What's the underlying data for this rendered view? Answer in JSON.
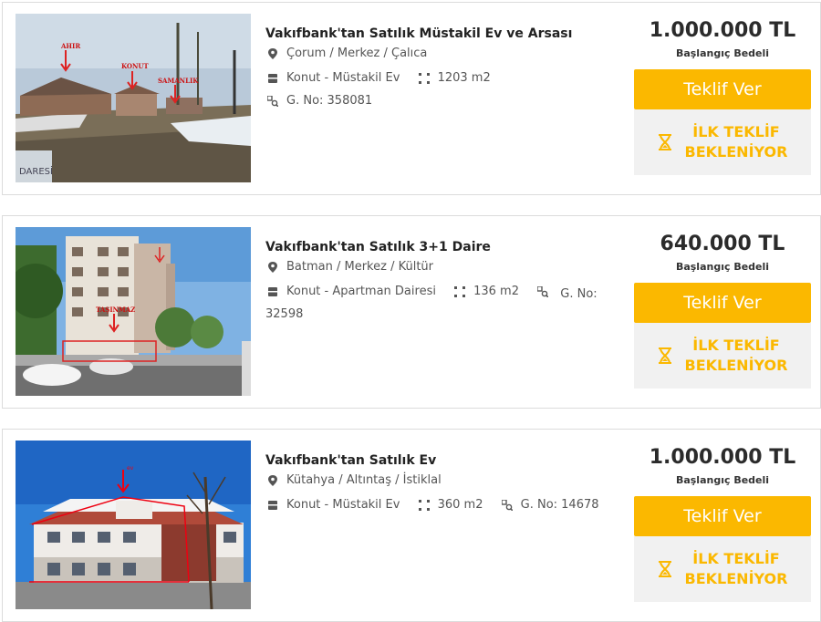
{
  "listings": [
    {
      "title": "Vakıfbank'tan Satılık Müstakil Ev ve Arsası",
      "location": "Çorum / Merkez / Çalıca",
      "type": "Konut - Müstakil Ev",
      "area": "1203 m2",
      "gno": "G. No: 358081",
      "price": "1.000.000 TL",
      "price_label": "Başlangıç Bedeli",
      "bid_button": "Teklif Ver",
      "status_line1": "İLK TEKLİF",
      "status_line2": "BEKLENİYOR",
      "photo_labels": [
        "AHIR",
        "KONUT",
        "SAMANLIK",
        "DARESİ"
      ]
    },
    {
      "title": "Vakıfbank'tan Satılık 3+1 Daire",
      "location": "Batman / Merkez / Kültür",
      "type": "Konut - Apartman Dairesi",
      "area": "136 m2",
      "gno": "G. No: 32598",
      "price": "640.000 TL",
      "price_label": "Başlangıç Bedeli",
      "bid_button": "Teklif Ver",
      "status_line1": "İLK TEKLİF",
      "status_line2": "BEKLENİYOR",
      "photo_labels": [
        "TAŞINMAZ"
      ]
    },
    {
      "title": "Vakıfbank'tan Satılık Ev",
      "location": "Kütahya / Altıntaş / İstiklal",
      "type": "Konut - Müstakil Ev",
      "area": "360 m2",
      "gno": "G. No: 14678",
      "price": "1.000.000 TL",
      "price_label": "Başlangıç Bedeli",
      "bid_button": "Teklif Ver",
      "status_line1": "İLK TEKLİF",
      "status_line2": "BEKLENİYOR",
      "photo_labels": [
        "ev"
      ]
    }
  ],
  "colors": {
    "accent": "#fbb800",
    "wait_bg": "#f1f1f1",
    "title": "#222222"
  },
  "icons": {
    "location": "map-pin-icon",
    "type": "building-icon",
    "area": "area-dots-icon",
    "gno": "parcel-icon",
    "status": "hourglass-icon"
  }
}
